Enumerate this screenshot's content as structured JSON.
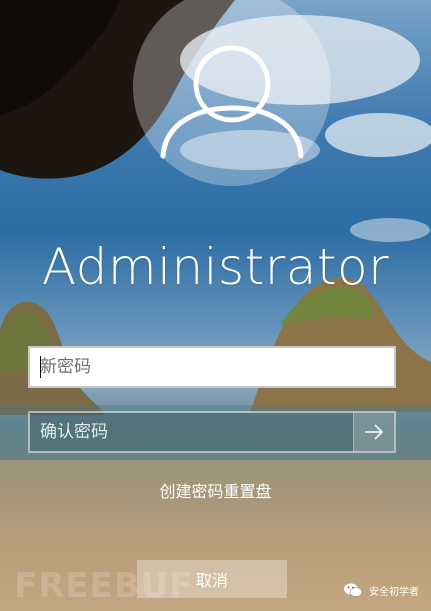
{
  "user": {
    "name": "Administrator"
  },
  "form": {
    "new_password_placeholder": "新密码",
    "confirm_password_placeholder": "确认密码"
  },
  "links": {
    "create_reset_disk": "创建密码重置盘"
  },
  "buttons": {
    "cancel": "取消"
  },
  "watermark": {
    "brand": "FREEBUF",
    "account": "安全初学者"
  },
  "icons": {
    "avatar": "user-avatar-icon",
    "submit": "arrow-right-icon",
    "wechat": "wechat-icon"
  }
}
